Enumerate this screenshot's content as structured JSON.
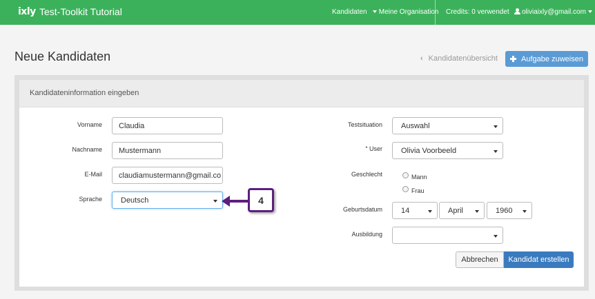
{
  "nav": {
    "logo": "ixly",
    "title": "Test-Toolkit Tutorial",
    "candidates": "Kandidaten",
    "organisation": "Meine Organisation",
    "credits": "Credits: 0 verwendet",
    "user": "oliviaixly@gmail.com"
  },
  "header": {
    "title": "Neue Kandidaten",
    "overview_link": "Kandidatenübersicht",
    "assign_button": "Aufgabe zuweisen"
  },
  "panel": {
    "heading": "Kandidateninformation eingeben"
  },
  "form": {
    "firstname_label": "Vorname",
    "firstname_value": "Claudia",
    "lastname_label": "Nachname",
    "lastname_value": "Mustermann",
    "email_label": "E-Mail",
    "email_value": "claudiamustermann@gmail.co",
    "language_label": "Sprache",
    "language_value": "Deutsch",
    "test_situation_label": "Testsituation",
    "test_situation_value": "Auswahl",
    "user_label_star": "*",
    "user_label": "User",
    "user_value": "Olivia Voorbeeld",
    "gender_label": "Geschlecht",
    "gender_male": "Mann",
    "gender_female": "Frau",
    "birthdate_label": "Geburtsdatum",
    "birth_day": "14",
    "birth_month": "April",
    "birth_year": "1960",
    "education_label": "Ausbildung",
    "education_value": ""
  },
  "actions": {
    "cancel": "Abbrechen",
    "create": "Kandidat erstellen"
  },
  "callout": {
    "number": "4"
  },
  "colors": {
    "nav_green": "#3cb15b",
    "primary_blue": "#3a7bbf",
    "callout_purple": "#5d1f7e"
  }
}
